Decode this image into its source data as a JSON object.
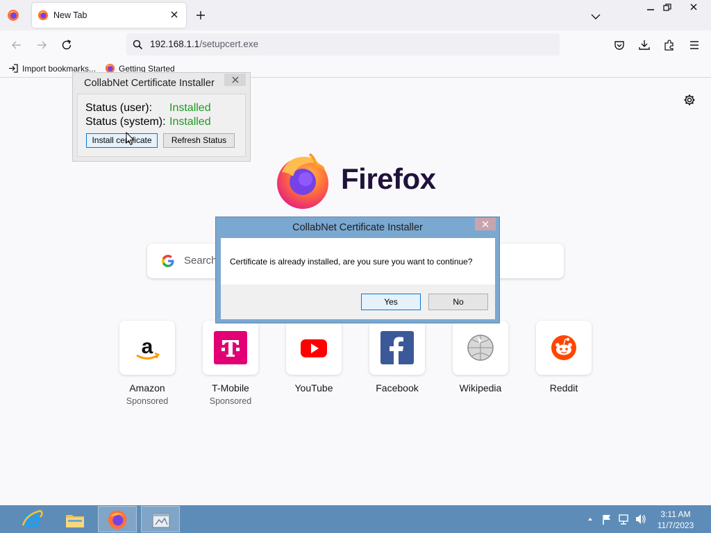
{
  "browser": {
    "tab": {
      "title": "New Tab"
    },
    "url": {
      "host": "192.168.1.1",
      "path": "/setupcert.exe"
    },
    "bookmarks": [
      {
        "label": "Import bookmarks..."
      },
      {
        "label": "Getting Started"
      }
    ]
  },
  "newtab": {
    "brand": "Firefox",
    "search_placeholder": "Search",
    "shortcuts": [
      {
        "name": "Amazon",
        "sponsored": "Sponsored"
      },
      {
        "name": "T-Mobile",
        "sponsored": "Sponsored"
      },
      {
        "name": "YouTube"
      },
      {
        "name": "Facebook"
      },
      {
        "name": "Wikipedia"
      },
      {
        "name": "Reddit"
      }
    ]
  },
  "installer": {
    "title": "CollabNet Certificate Installer",
    "status_user_label": "Status (user):",
    "status_user_value": "Installed",
    "status_system_label": "Status (system):",
    "status_system_value": "Installed",
    "install_button": "Install certificate",
    "refresh_button": "Refresh Status"
  },
  "dialog": {
    "title": "CollabNet Certificate Installer",
    "message": "Certificate is already installed, are you sure you want to continue?",
    "yes": "Yes",
    "no": "No"
  },
  "taskbar": {
    "time": "3:11 AM",
    "date": "11/7/2023"
  },
  "colors": {
    "installed_green": "#1f9a1f",
    "taskbar_blue": "#5d8cb8",
    "dialog_frame": "#7ba8d1"
  }
}
